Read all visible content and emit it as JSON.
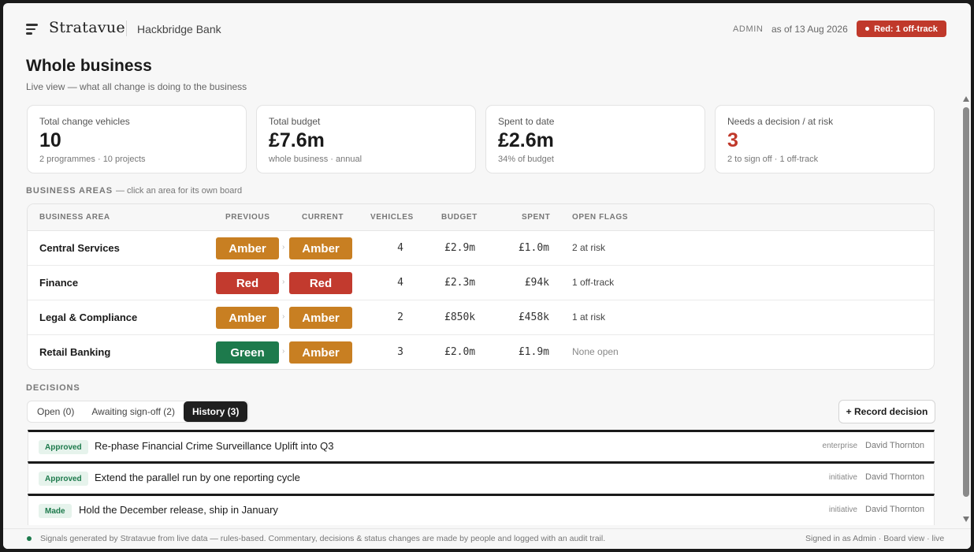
{
  "header": {
    "brand": "Stratavue",
    "org": "Hackbridge Bank",
    "role": "ADMIN",
    "as_of": "as of 13 Aug 2026",
    "status_pill": "Red: 1 off-track"
  },
  "page": {
    "title": "Whole business",
    "subtitle": "Live view — what all change is doing to the business"
  },
  "stats": [
    {
      "label": "Total change vehicles",
      "value": "10",
      "note": "2 programmes · 10 projects"
    },
    {
      "label": "Total budget",
      "value": "£7.6m",
      "note": "whole business · annual"
    },
    {
      "label": "Spent to date",
      "value": "£2.6m",
      "note": "34% of budget"
    },
    {
      "label": "Needs a decision / at risk",
      "value": "3",
      "note": "2 to sign off · 1 off-track"
    }
  ],
  "areas_section": {
    "label": "BUSINESS AREAS",
    "hint": "— click an area for its own board"
  },
  "areas_table": {
    "columns": [
      "BUSINESS AREA",
      "PREVIOUS",
      "CURRENT",
      "VEHICLES",
      "BUDGET",
      "SPENT",
      "OPEN FLAGS"
    ],
    "rows": [
      {
        "name": "Central Services",
        "previous": "Amber",
        "current": "Amber",
        "vehicles": "4",
        "budget": "£2.9m",
        "spent": "£1.0m",
        "flags": "2 at risk"
      },
      {
        "name": "Finance",
        "previous": "Red",
        "current": "Red",
        "vehicles": "4",
        "budget": "£2.3m",
        "spent": "£94k",
        "flags": "1 off-track"
      },
      {
        "name": "Legal & Compliance",
        "previous": "Amber",
        "current": "Amber",
        "vehicles": "2",
        "budget": "£850k",
        "spent": "£458k",
        "flags": "1 at risk"
      },
      {
        "name": "Retail Banking",
        "previous": "Green",
        "current": "Amber",
        "vehicles": "3",
        "budget": "£2.0m",
        "spent": "£1.9m",
        "flags": "None open"
      }
    ]
  },
  "decisions_section": {
    "label": "DECISIONS",
    "tabs": [
      "Open (0)",
      "Awaiting sign-off (2)",
      "History (3)"
    ],
    "active_tab": "History (3)",
    "record_button": "+ Record decision",
    "items": [
      {
        "badge": "Approved",
        "title": "Re-phase Financial Crime Surveillance Uplift into Q3",
        "scope": "enterprise",
        "owner": "David Thornton"
      },
      {
        "badge": "Approved",
        "title": "Extend the parallel run by one reporting cycle",
        "scope": "initiative",
        "owner": "David Thornton"
      },
      {
        "badge": "Made",
        "title": "Hold the December release, ship in January",
        "scope": "initiative",
        "owner": "David Thornton"
      }
    ]
  },
  "footer": {
    "left": "Signals generated by Stratavue from live data — rules-based. Commentary, decisions & status changes are made by people and logged with an audit trail.",
    "right": "Signed in as Admin · Board view · live"
  },
  "colors": {
    "red": "#c23a2e",
    "amber": "#c87f22",
    "green": "#1d7a4c"
  }
}
